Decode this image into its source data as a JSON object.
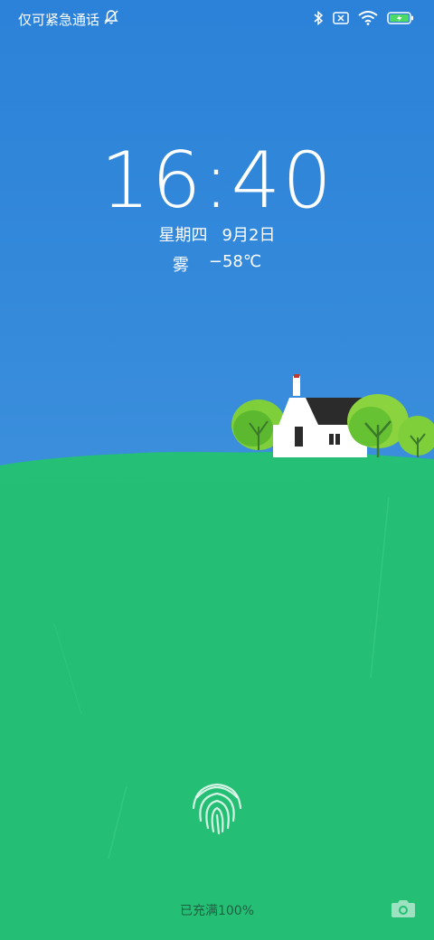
{
  "status_bar": {
    "carrier_text": "仅可紧急通话",
    "icons": [
      "notifications-muted-icon",
      "bluetooth-icon",
      "no-sim-icon",
      "wifi-icon",
      "battery-charging-icon"
    ],
    "battery_percent": 100
  },
  "lockscreen": {
    "time": "16:40",
    "weekday": "星期四",
    "date": "9月2日",
    "weather_condition": "雾",
    "temperature": "−58℃",
    "charging_status": "已充满100%"
  },
  "colors": {
    "sky": "#2f86da",
    "grass": "#24bf74",
    "text": "#ffffff"
  },
  "controls": {
    "fingerprint": "fingerprint-icon",
    "camera": "camera-icon"
  }
}
